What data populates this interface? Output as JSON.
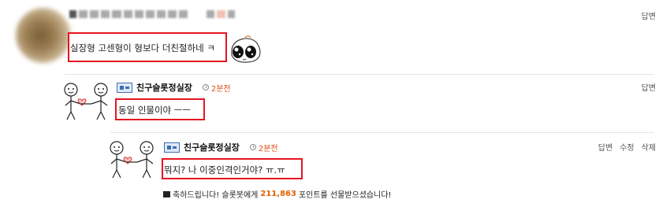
{
  "comments": [
    {
      "text": "실장형 고센형이 형보다 더친절하네 ㅋ",
      "reply": "답변"
    },
    {
      "author": "친구슬롯정실장",
      "time": "2분전",
      "text": "동일 인물이야 ㅡㅡ",
      "reply": "답변"
    },
    {
      "author": "친구슬롯정실장",
      "time": "2분전",
      "text": "뭐지? 나 이중인격인거야? ㅠ.ㅠ",
      "actions": [
        "답변",
        "수정",
        "삭제"
      ],
      "points": {
        "prefix": "축하드립니다! 슬롯봇에게",
        "amount": "211,863",
        "suffix": "포인트를 선물받으셨습니다!"
      }
    }
  ],
  "colors": {
    "highlight_border": "#e8141f",
    "time": "#e04e1b",
    "points": "#e06100"
  },
  "icons": [
    "user-avatar",
    "emoticon-face",
    "couple-avatar",
    "user-badge-icon",
    "clock-icon",
    "gift-icon"
  ]
}
